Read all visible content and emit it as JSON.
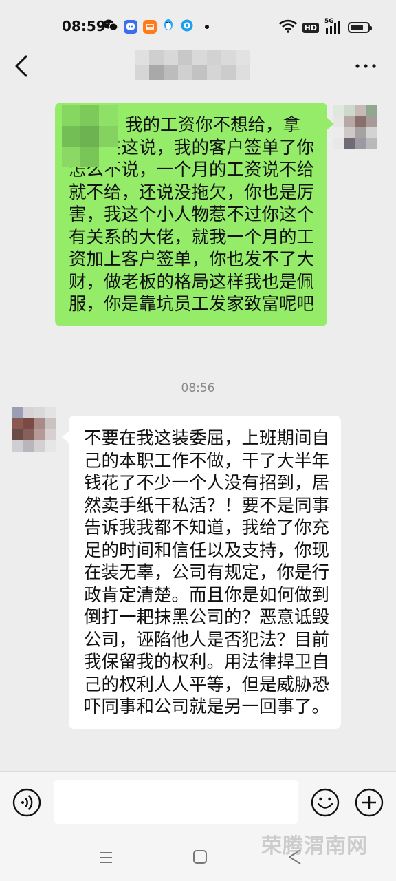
{
  "status_bar": {
    "time": "08:59",
    "hd": "HD",
    "network": "5G",
    "battery_level": 0.75,
    "app_icons": [
      "wechat-icon",
      "qq-chat-icon",
      "shop-app-icon",
      "qq-penguin-icon",
      "browser-icon"
    ]
  },
  "header": {
    "back_icon": "chevron-left-icon",
    "title": "",
    "more_icon": "more-dots-icon"
  },
  "messages": [
    {
      "sender": "self",
      "bubble_color": "#95ec69",
      "text": "我的工资你不想给，拿和我在这说，我的客户签单了你怎么不说，一个月的工资说不给就不给，还说没拖欠，你也是厉害，我这个小人物惹不过你这个有关系的大佬，就我一个月的工资加上客户签单，你也发不了大财，做老板的格局这样我也是佩服，你是靠坑员工发家致富呢吧"
    },
    {
      "timestamp": "08:56"
    },
    {
      "sender": "other",
      "bubble_color": "#ffffff",
      "text": "不要在我这装委屈，上班期间自己的本职工作不做，干了大半年钱花了不少一个人没有招到，居然卖手纸干私活？！要不是同事告诉我我都不知道，我给了你充足的时间和信任以及支持，你现在装无辜，公司有规定，你是行政肯定清楚。而且你是如何做到倒打一耙抹黑公司的？恶意诋毁公司，诬陷他人是否犯法？目前我保留我的权利。用法律捍卫自己的权利人人平等，但是威胁恐吓同事和公司就是另一回事了。"
    }
  ],
  "input_bar": {
    "voice_icon": "voice-icon",
    "input_value": "",
    "emoji_icon": "emoji-icon",
    "plus_icon": "plus-icon"
  },
  "nav_bar": {
    "icons": [
      "menu-icon",
      "home-icon",
      "back-icon"
    ]
  },
  "watermark": "荣腾渭南网"
}
